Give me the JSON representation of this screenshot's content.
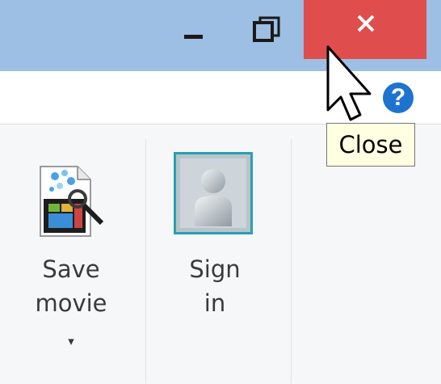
{
  "titlebar": {
    "minimize": "minimize",
    "maximize": "maximize",
    "close": "close",
    "close_color": "#df4d4d",
    "bar_color": "#9cbfe3"
  },
  "help": {
    "label": "?"
  },
  "ribbon": {
    "save_movie": {
      "line1": "Save",
      "line2": "movie",
      "dropdown": "▾"
    },
    "sign_in": {
      "line1": "Sign",
      "line2": "in"
    }
  },
  "tooltip": {
    "text": "Close"
  },
  "icons": {
    "minimize": "minimize-icon",
    "maximize": "maximize-icon",
    "close": "close-icon",
    "help": "help-icon",
    "save_movie": "save-movie-icon",
    "sign_in": "user-avatar-icon",
    "cursor": "mouse-cursor-icon"
  }
}
